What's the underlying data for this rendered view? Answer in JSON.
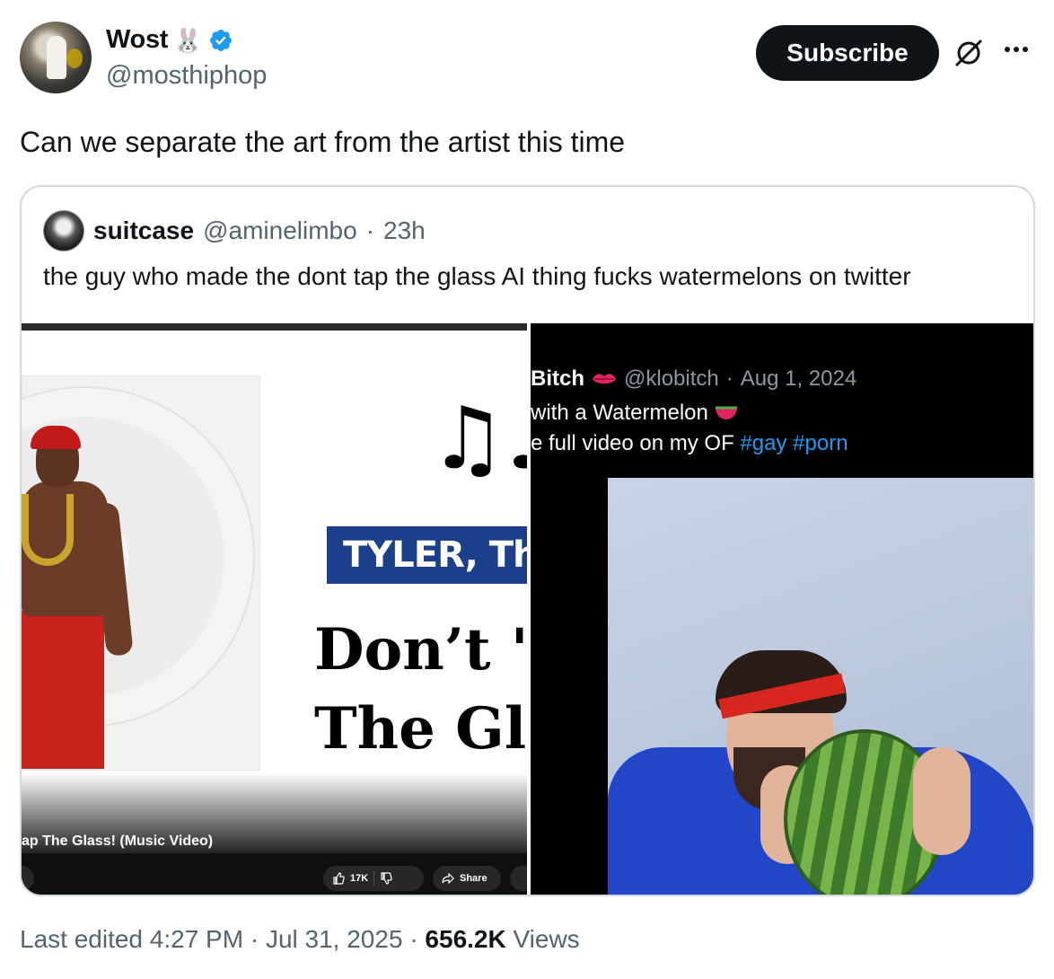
{
  "author": {
    "display_name": "Wost",
    "emoji": "🐰",
    "handle": "@mosthiphop"
  },
  "actions": {
    "subscribe_label": "Subscribe"
  },
  "tweet": {
    "text": "Can we separate the art from the artist this time"
  },
  "quote": {
    "name": "suitcase",
    "handle": "@aminelimbo",
    "sep": "·",
    "time": "23h",
    "text": "the guy who made the dont tap the glass AI thing fucks watermelons on twitter",
    "media_left": {
      "tyler_text": "TYLER, The C",
      "dont_line1": "Don’t '",
      "dont_line2": "The Gl",
      "yt_title": "ap The Glass! (Music Video)",
      "like_count": "17K",
      "share_label": "Share"
    },
    "media_right": {
      "name": "Bitch",
      "handle": "@klobitch",
      "sep": "·",
      "date": "Aug 1, 2024",
      "line1": "with a Watermelon",
      "line2_prefix": "e full video on my OF",
      "tag1": "#gay",
      "tag2": "#porn"
    }
  },
  "footer": {
    "prefix": "Last edited",
    "time": "4:27 PM",
    "sep1": "·",
    "date": "Jul 31, 2025",
    "sep2": "·",
    "views_count": "656.2K",
    "views_label": "Views"
  },
  "colors": {
    "verified": "#1d9bf0",
    "text": "#0f1419",
    "muted": "#536471",
    "border": "#cfd9de",
    "link": "#1d9bf0"
  },
  "icons": [
    "verified-icon",
    "grok-icon",
    "more-icon",
    "music-notes-icon",
    "thumbs-up-icon",
    "thumbs-down-icon",
    "share-icon",
    "lips-icon",
    "watermelon-icon"
  ]
}
